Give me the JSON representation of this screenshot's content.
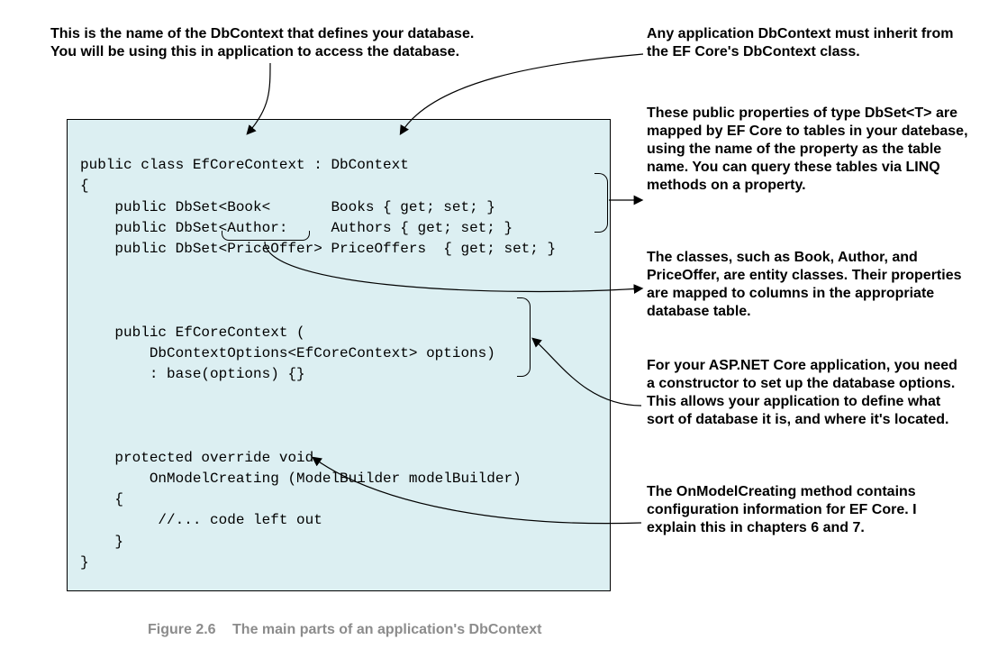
{
  "caption": {
    "figno": "Figure 2.6",
    "text": "The main parts of an application's DbContext"
  },
  "annotations": {
    "topLeft": "This is the name of the DbContext that defines your database.\nYou will be using this in application to access the database.",
    "r1": "Any application DbContext must inherit from the EF Core's DbContext class.",
    "r2": "These public properties of type DbSet<T> are mapped by EF Core to tables in your datebase, using the name of the property as the table name. You can query these tables via LINQ methods on a property.",
    "r3": "The classes, such as Book, Author, and PriceOffer, are entity classes. Their properties are mapped to columns in the appropriate database table.",
    "r4": "For your ASP.NET Core application, you need a constructor to set up the database options. This allows your application to define what sort of database it is, and where it's located.",
    "r5": "The OnModelCreating method contains configuration information for EF Core. I explain this in chapters 6 and 7."
  },
  "code": {
    "l1": "public class EfCoreContext : DbContext",
    "l2": "{",
    "l3": "    public DbSet<Book<       Books { get; set; }",
    "l4": "    public DbSet<Author:     Authors { get; set; }",
    "l5": "    public DbSet<PriceOffer> PriceOffers  { get; set; }",
    "l6": "",
    "l7": "",
    "l8": "",
    "l9": "    public EfCoreContext (",
    "l10": "        DbContextOptions<EfCoreContext> options)",
    "l11": "        : base(options) {}",
    "l12": "",
    "l13": "",
    "l14": "",
    "l15": "    protected override void",
    "l16": "        OnModelCreating (ModelBuilder modelBuilder)",
    "l17": "    {",
    "l18": "         //... code left out",
    "l19": "    }",
    "l20": "}"
  }
}
